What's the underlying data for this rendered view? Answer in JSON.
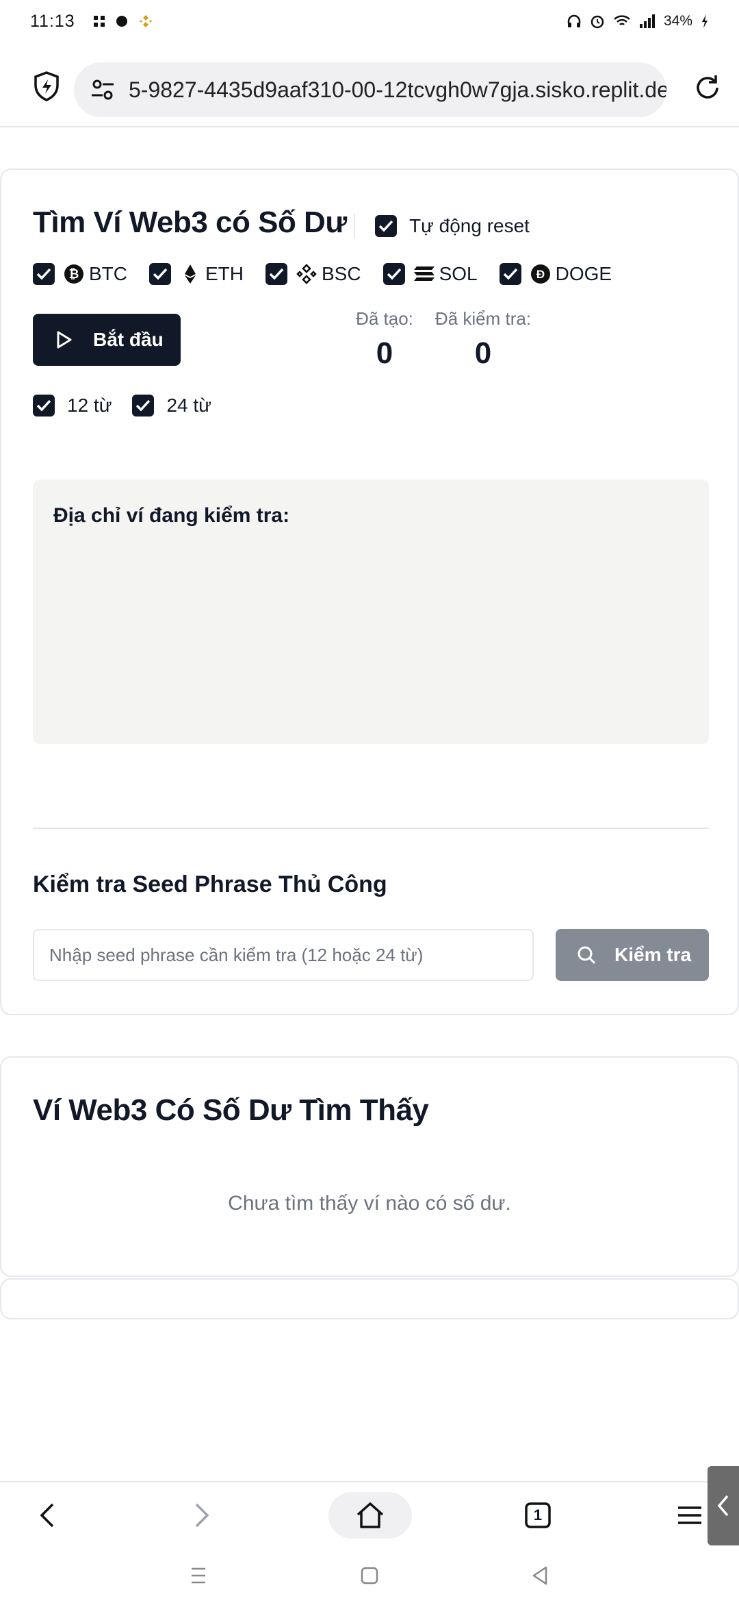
{
  "status_bar": {
    "time": "11:13",
    "battery": "34%"
  },
  "browser": {
    "url": "5-9827-4435d9aaf310-00-12tcvgh0w7gja.sisko.replit.dev",
    "tabs_count": "1"
  },
  "scanner": {
    "title": "Tìm Ví Web3 có Số Dư",
    "auto_reset_label": "Tự động reset",
    "chains": [
      {
        "label": "BTC",
        "icon": "bitcoin-icon"
      },
      {
        "label": "ETH",
        "icon": "ethereum-icon"
      },
      {
        "label": "BSC",
        "icon": "binance-icon"
      },
      {
        "label": "SOL",
        "icon": "solana-icon"
      },
      {
        "label": "DOGE",
        "icon": "dogecoin-icon"
      }
    ],
    "start_button": "Bắt đầu",
    "stats": {
      "created_label": "Đã tạo:",
      "created_value": "0",
      "checked_label": "Đã kiểm tra:",
      "checked_value": "0"
    },
    "word_options": [
      "12 từ",
      "24 từ"
    ],
    "address_box_title": "Địa chỉ ví đang kiểm tra:"
  },
  "manual": {
    "title": "Kiểm tra Seed Phrase Thủ Công",
    "input_placeholder": "Nhập seed phrase cần kiểm tra (12 hoặc 24 từ)",
    "check_button": "Kiểm tra"
  },
  "found": {
    "title": "Ví Web3 Có Số Dư Tìm Thấy",
    "empty_message": "Chưa tìm thấy ví nào có số dư."
  },
  "colors": {
    "primary": "#111827",
    "disabled_button": "#858b94",
    "panel_bg": "#f4f4f3"
  }
}
